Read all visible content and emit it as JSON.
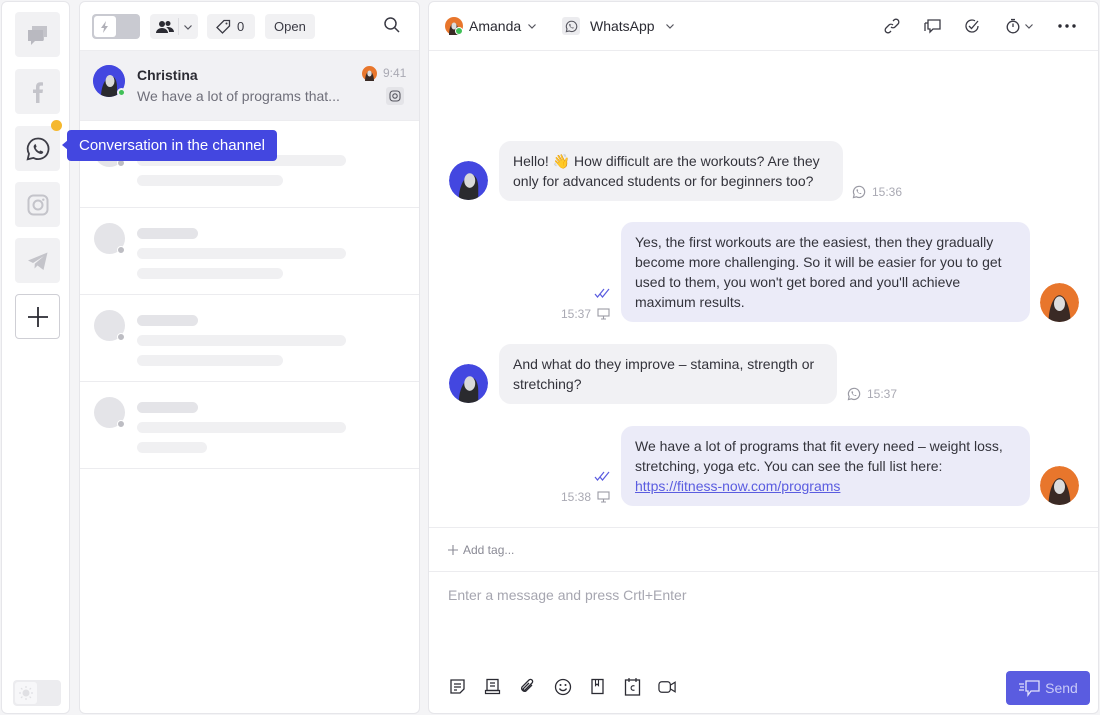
{
  "rail": {
    "channels": [
      {
        "name": "all-conversations",
        "icon": "chat-bubbles-icon",
        "active": false
      },
      {
        "name": "facebook",
        "icon": "facebook-icon",
        "active": false
      },
      {
        "name": "whatsapp",
        "icon": "whatsapp-icon",
        "active": true,
        "has_badge": true
      },
      {
        "name": "instagram",
        "icon": "instagram-icon",
        "active": false
      },
      {
        "name": "telegram",
        "icon": "telegram-icon",
        "active": false
      }
    ],
    "add_icon": "plus-icon",
    "theme_toggle_icon": "sun-icon",
    "badge_color": "#f5b82e"
  },
  "tooltip": {
    "text": "Conversation in the channel",
    "color": "#4347e0"
  },
  "list": {
    "toolbar": {
      "bolt_icon": "lightning-icon",
      "team_icon": "users-icon",
      "tag_count": "0",
      "status": "Open",
      "search_icon": "search-icon"
    },
    "active_conversation": {
      "name": "Christina",
      "preview": "We have a lot of programs that...",
      "time": "9:41",
      "channel_icon": "instagram-icon",
      "online": true
    },
    "placeholder_count": 4
  },
  "chat": {
    "header": {
      "agent": "Amanda",
      "channel": "WhatsApp",
      "actions": [
        "link-icon",
        "comments-icon",
        "check-circle-icon",
        "timer-icon",
        "more-icon"
      ]
    },
    "messages": [
      {
        "direction": "in",
        "text": "Hello! 👋 How difficult are the workouts? Are they only for advanced students or for beginners too?",
        "time": "15:36",
        "channel_icon": "whatsapp-icon"
      },
      {
        "direction": "out",
        "text": "Yes, the first workouts are the easiest, then they gradually become more challenging. So it will be easier for you to get used to them, you won't get bored and you'll achieve maximum results.",
        "time": "15:37",
        "source_icon": "desktop-icon",
        "read": true
      },
      {
        "direction": "in",
        "text": "And what do they improve – stamina, strength or stretching?",
        "time": "15:37",
        "channel_icon": "whatsapp-icon"
      },
      {
        "direction": "out",
        "text": "We have a lot of programs that fit every need – weight loss, stretching, yoga etc. You can see the full list here:",
        "link": "https://fitness-now.com/programs",
        "time": "15:38",
        "source_icon": "desktop-icon",
        "read": true
      }
    ],
    "add_tag": "Add tag...",
    "composer_placeholder": "Enter a message and press Crtl+Enter",
    "tools": [
      "template-icon",
      "knowledge-base-icon",
      "attachment-icon",
      "emoji-icon",
      "bookmark-icon",
      "calendar-icon",
      "video-icon"
    ],
    "send_label": "Send",
    "accent": "#5a5ce0"
  }
}
